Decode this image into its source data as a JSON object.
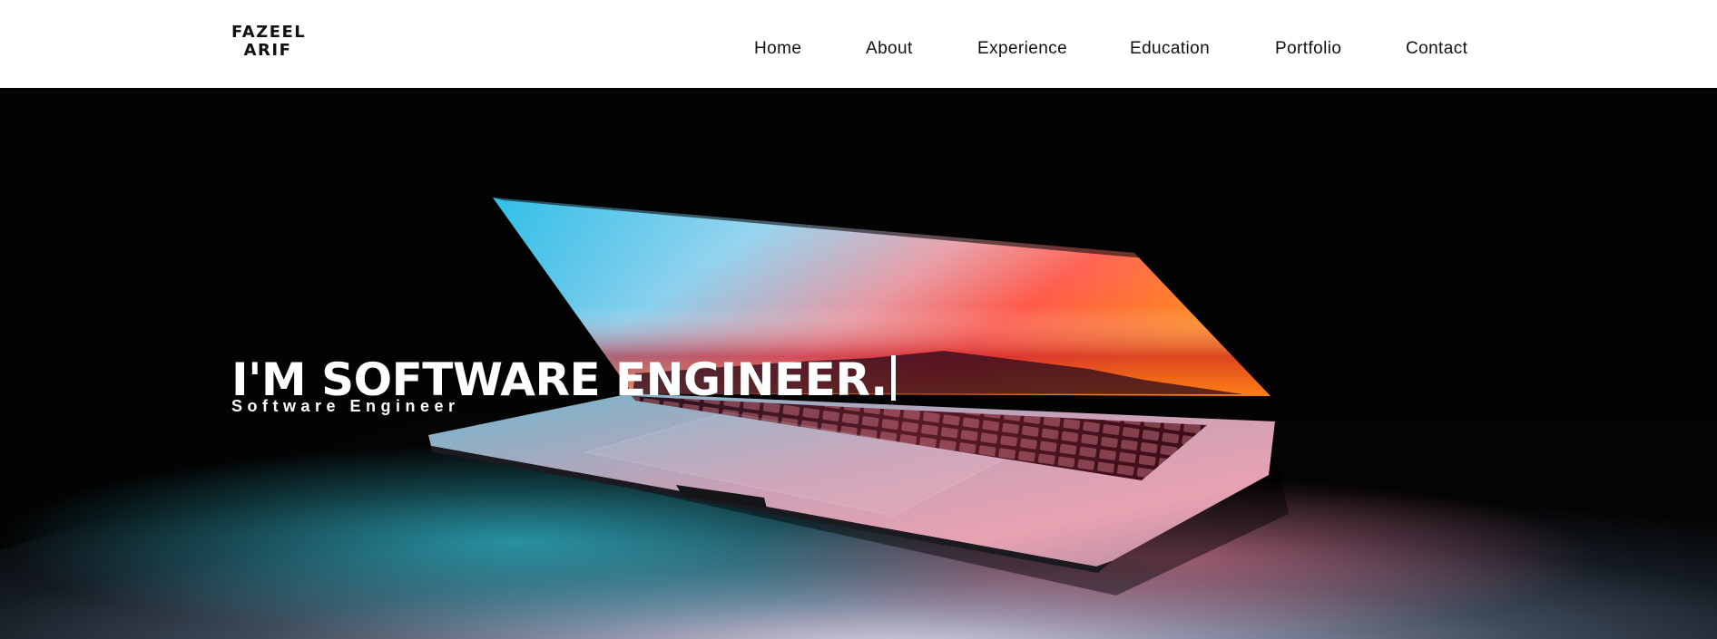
{
  "header": {
    "logo": {
      "line1": "FAZEEL",
      "line2": "ARIF"
    },
    "nav": [
      {
        "label": "Home"
      },
      {
        "label": "About"
      },
      {
        "label": "Experience"
      },
      {
        "label": "Education"
      },
      {
        "label": "Portfolio"
      },
      {
        "label": "Contact"
      }
    ]
  },
  "hero": {
    "title": "I'M SOFTWARE ENGINEER.",
    "subtitle": "Software Engineer",
    "background_image": "laptop-glowing-screen"
  },
  "colors": {
    "nav_background": "#ffffff",
    "nav_text": "#111111",
    "hero_background": "#030303",
    "hero_text": "#ffffff"
  }
}
